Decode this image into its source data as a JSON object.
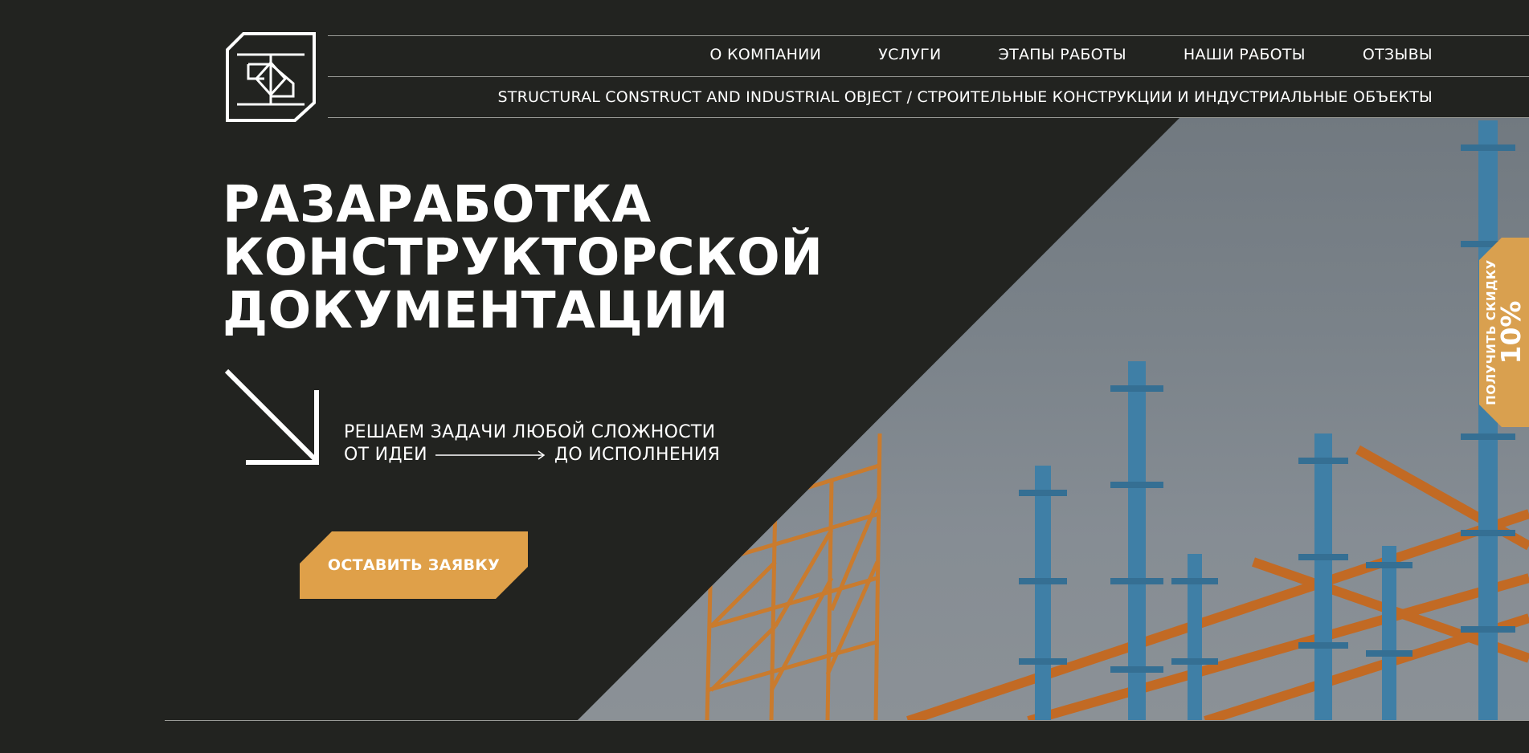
{
  "header": {
    "logo_name": "company-logo",
    "nav": [
      {
        "label": "О КОМПАНИИ"
      },
      {
        "label": "УСЛУГИ"
      },
      {
        "label": "ЭТАПЫ РАБОТЫ"
      },
      {
        "label": "НАШИ РАБОТЫ"
      },
      {
        "label": "ОТЗЫВЫ"
      }
    ],
    "tagline": "STRUCTURAL CONSTRUCT AND INDUSTRIAL OBJECT / СТРОИТЕЛЬНЫЕ КОНСТРУКЦИИ И ИНДУСТРИАЛЬНЫЕ ОБЪЕКТЫ"
  },
  "hero": {
    "title_lines": [
      "РАЗАРАБОТКА",
      "КОНСТРУКТОРСКОЙ",
      "ДОКУМЕНТАЦИИ"
    ],
    "slogan_line1": "РЕШАЕМ ЗАДАЧИ ЛЮБОЙ СЛОЖНОСТИ",
    "slogan_from": "ОТ ИДЕИ",
    "slogan_to": "ДО ИСПОЛНЕНИЯ",
    "cta_label": "ОСТАВИТЬ ЗАЯВКУ",
    "image_subject": "steel-structure-construction-photo"
  },
  "discount_tab": {
    "label": "ПОЛУЧИТЬ СКИДКУ",
    "value": "10%"
  },
  "colors": {
    "background": "#222320",
    "accent": "#dfa049",
    "text": "#ffffff",
    "rule": "#9a9b97"
  }
}
